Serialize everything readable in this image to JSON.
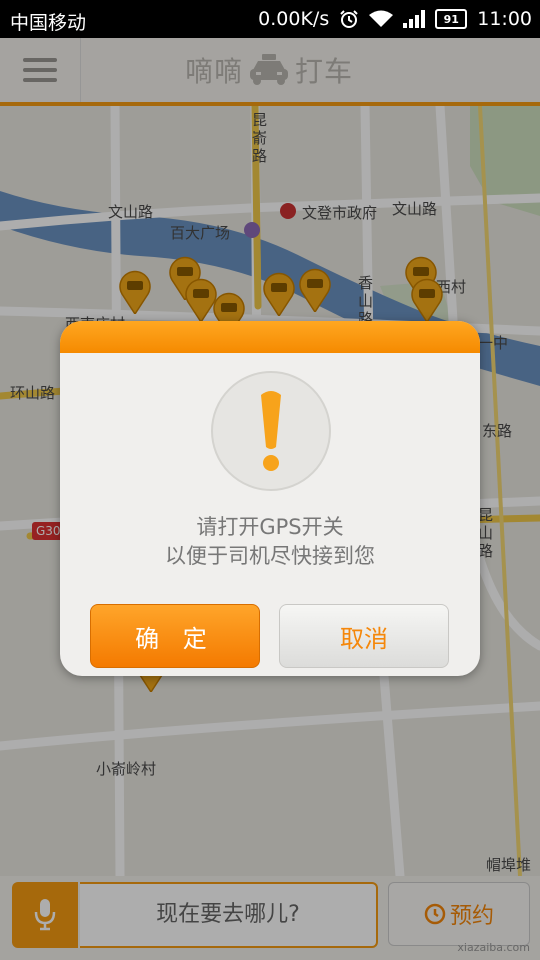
{
  "status_bar": {
    "carrier": "中国移动",
    "speed": "0.00K/s",
    "battery": "91",
    "time": "11:00"
  },
  "header": {
    "title_left": "嘀嘀",
    "title_right": "打车"
  },
  "map": {
    "labels": [
      "昆嵛路",
      "文山路",
      "文登市政府",
      "文山路",
      "百大广场",
      "西村",
      "西南庄村",
      "香山路",
      "一中",
      "环山路",
      "东路",
      "G30",
      "昆山路",
      "小嵛岭村",
      "帽埠堆"
    ]
  },
  "dialog": {
    "message_line1": "请打开GPS开关",
    "message_line2": "以便于司机尽快接到您",
    "ok_label": "确 定",
    "cancel_label": "取消"
  },
  "bottom": {
    "input_placeholder": "现在要去哪儿?",
    "reserve_label": "预约"
  },
  "watermark": "xiazaiba.com",
  "colors": {
    "accent": "#f59b12",
    "accent_dark": "#f47a00",
    "cancel_text": "#f5870a"
  }
}
